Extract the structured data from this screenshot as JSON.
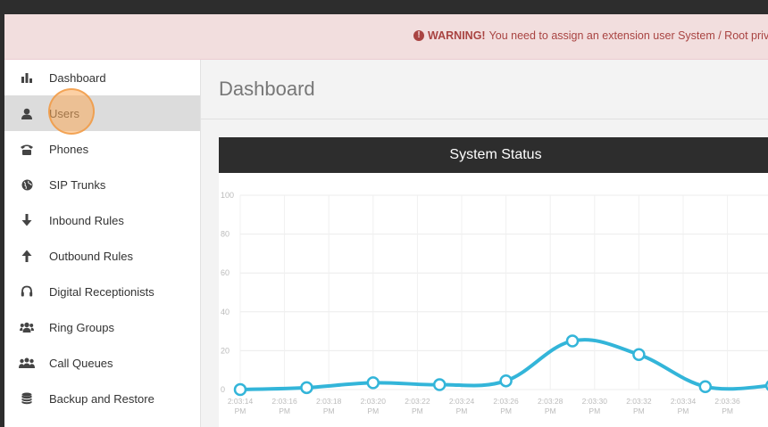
{
  "warning": {
    "icon": "exclamation-circle-icon",
    "label": "WARNING!",
    "text": "You need to assign an extension user System / Root privileg"
  },
  "sidebar": {
    "items": [
      {
        "label": "Dashboard",
        "icon": "bar-chart-icon"
      },
      {
        "label": "Users",
        "icon": "user-icon",
        "active": true
      },
      {
        "label": "Phones",
        "icon": "phone-icon"
      },
      {
        "label": "SIP Trunks",
        "icon": "globe-icon"
      },
      {
        "label": "Inbound Rules",
        "icon": "arrow-down-icon"
      },
      {
        "label": "Outbound Rules",
        "icon": "arrow-up-icon"
      },
      {
        "label": "Digital Receptionists",
        "icon": "headset-icon"
      },
      {
        "label": "Ring Groups",
        "icon": "group-icon"
      },
      {
        "label": "Call Queues",
        "icon": "queue-icon"
      },
      {
        "label": "Backup and Restore",
        "icon": "database-icon"
      }
    ]
  },
  "main": {
    "page_title": "Dashboard",
    "panel_title": "System Status"
  },
  "colors": {
    "line": "#33b5d9",
    "warning_bg": "#f2dede",
    "warning_text": "#a94442",
    "panel_header": "#2d2d2d",
    "active_item": "#dcdcdc"
  },
  "chart_data": {
    "type": "line",
    "title": "System Status",
    "ylim": [
      0,
      100
    ],
    "yticks": [
      0,
      20,
      40,
      60,
      80,
      100
    ],
    "x_tick_labels": [
      [
        "2:03:14",
        "PM"
      ],
      [
        "2:03:16",
        "PM"
      ],
      [
        "2:03:18",
        "PM"
      ],
      [
        "2:03:20",
        "PM"
      ],
      [
        "2:03:22",
        "PM"
      ],
      [
        "2:03:24",
        "PM"
      ],
      [
        "2:03:26",
        "PM"
      ],
      [
        "2:03:28",
        "PM"
      ],
      [
        "2:03:30",
        "PM"
      ],
      [
        "2:03:32",
        "PM"
      ],
      [
        "2:03:34",
        "PM"
      ],
      [
        "2:03:36",
        "PM"
      ]
    ],
    "points": [
      {
        "x": "2:03:14 PM",
        "y": 0
      },
      {
        "x": "2:03:17 PM",
        "y": 1
      },
      {
        "x": "2:03:20 PM",
        "y": 3.5
      },
      {
        "x": "2:03:23 PM",
        "y": 2.5
      },
      {
        "x": "2:03:26 PM",
        "y": 4.5
      },
      {
        "x": "2:03:29 PM",
        "y": 25
      },
      {
        "x": "2:03:32 PM",
        "y": 18
      },
      {
        "x": "2:03:35 PM",
        "y": 1.5
      },
      {
        "x": "2:03:38 PM",
        "y": 2
      }
    ],
    "grid": true,
    "legend": "none"
  }
}
